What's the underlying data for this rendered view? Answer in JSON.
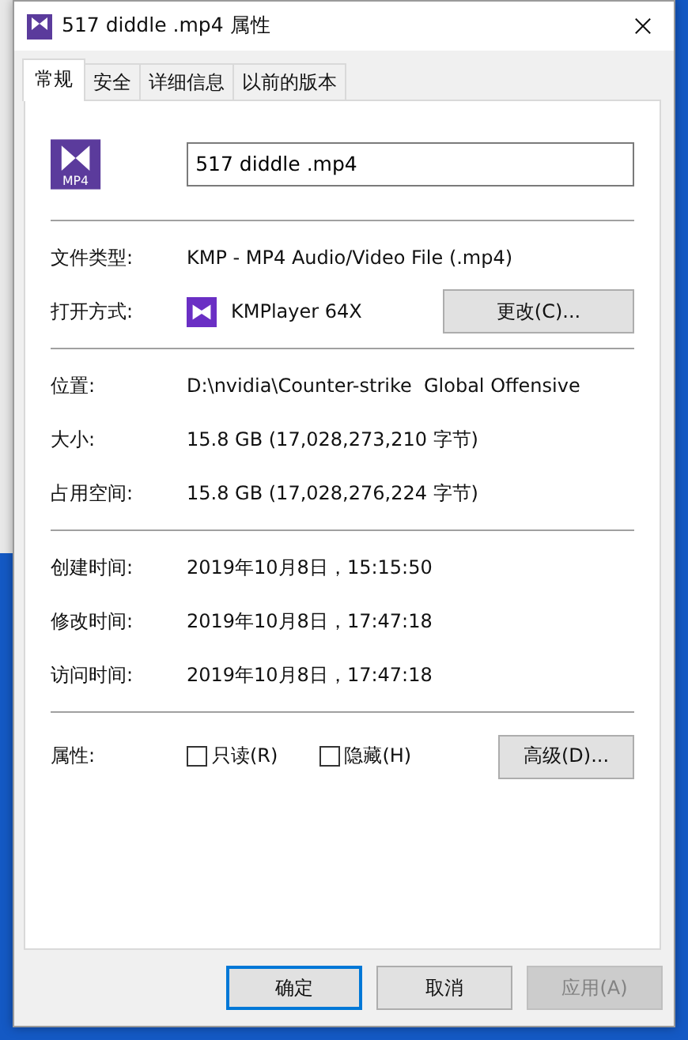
{
  "window": {
    "title": "517 diddle .mp4 属性"
  },
  "tabs": [
    {
      "label": "常规",
      "selected": true
    },
    {
      "label": "安全",
      "selected": false
    },
    {
      "label": "详细信息",
      "selected": false
    },
    {
      "label": "以前的版本",
      "selected": false
    }
  ],
  "file_icon_label": "MP4",
  "file_name": "517 diddle .mp4",
  "sections": [
    [
      {
        "kind": "text",
        "label": "文件类型:",
        "value": "KMP - MP4 Audio/Video File (.mp4)"
      },
      {
        "kind": "app",
        "label": "打开方式:",
        "value": "KMPlayer 64X",
        "button": "更改(C)..."
      }
    ],
    [
      {
        "kind": "text",
        "label": "位置:",
        "value": "D:\\nvidia\\Counter-strike  Global Offensive"
      },
      {
        "kind": "text",
        "label": "大小:",
        "value": "15.8 GB (17,028,273,210 字节)"
      },
      {
        "kind": "text",
        "label": "占用空间:",
        "value": "15.8 GB (17,028,276,224 字节)"
      }
    ],
    [
      {
        "kind": "text",
        "label": "创建时间:",
        "value": "2019年10月8日，15:15:50"
      },
      {
        "kind": "text",
        "label": "修改时间:",
        "value": "2019年10月8日，17:47:18"
      },
      {
        "kind": "text",
        "label": "访问时间:",
        "value": "2019年10月8日，17:47:18"
      }
    ]
  ],
  "attributes": {
    "label": "属性:",
    "checkboxes": [
      {
        "label": "只读(R)",
        "checked": false
      },
      {
        "label": "隐藏(H)",
        "checked": false
      }
    ],
    "button": "高级(D)..."
  },
  "buttons": [
    {
      "label": "确定",
      "default": true,
      "disabled": false
    },
    {
      "label": "取消",
      "default": false,
      "disabled": false
    },
    {
      "label": "应用(A)",
      "default": false,
      "disabled": true
    }
  ]
}
